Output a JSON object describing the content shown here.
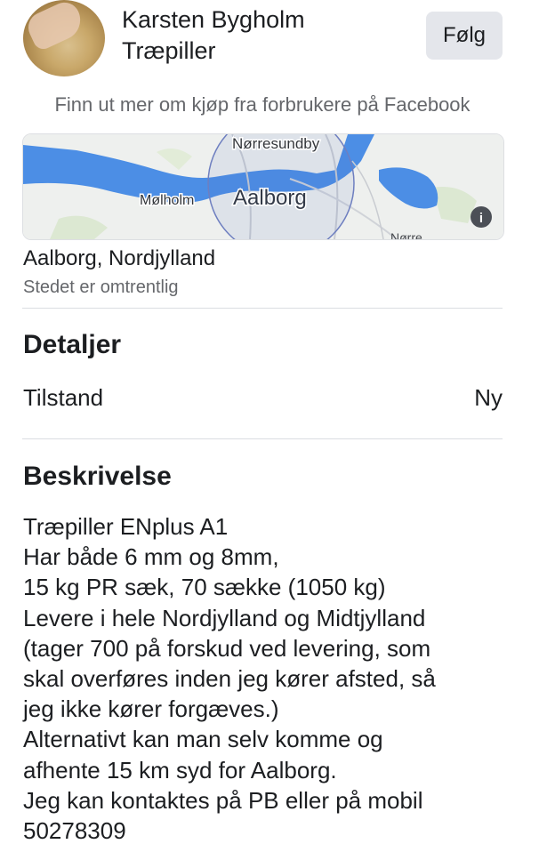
{
  "seller": {
    "name": "Karsten Bygholm",
    "listing_title": "Træpiller",
    "follow_label": "Følg"
  },
  "facebook_link": "Finn ut mer om kjøp fra forbrukere på Facebook",
  "map": {
    "labels": [
      "Nørresundby",
      "Mølholm",
      "Aalborg",
      "Nørre"
    ],
    "water_color": "#4c8ee5",
    "land_color": "#eef0ee"
  },
  "location": {
    "place": "Aalborg, Nordjylland",
    "note": "Stedet er omtrentlig"
  },
  "details": {
    "title": "Detaljer",
    "condition_label": "Tilstand",
    "condition_value": "Ny"
  },
  "description": {
    "title": "Beskrivelse",
    "lines": [
      "Træpiller ENplus A1",
      "Har både 6 mm og 8mm,",
      "15 kg PR sæk, 70 sække (1050 kg)",
      "Levere i hele Nordjylland og Midtjylland",
      "(tager 700 på forskud ved levering, som",
      "skal overføres inden jeg kører afsted, så",
      "jeg ikke kører forgæves.)",
      "Alternativt kan man selv komme og",
      "afhente 15 km syd for Aalborg.",
      "Jeg kan kontaktes på PB eller på mobil",
      "50278309"
    ]
  }
}
